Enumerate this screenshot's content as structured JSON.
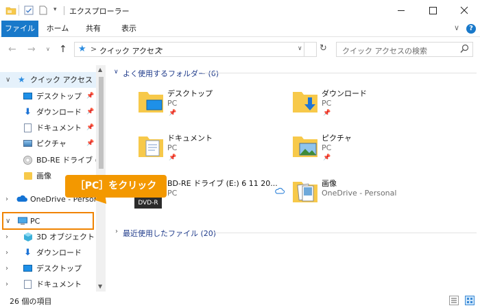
{
  "window": {
    "title": "エクスプローラー",
    "controls": [
      "minimize",
      "maximize",
      "close"
    ]
  },
  "ribbon": {
    "tabs": [
      {
        "label": "ファイル",
        "active": true
      },
      {
        "label": "ホーム"
      },
      {
        "label": "共有"
      },
      {
        "label": "表示"
      }
    ]
  },
  "address": {
    "path": "クイック アクセス",
    "separator": ">"
  },
  "search": {
    "placeholder": "クイック アクセスの検索"
  },
  "nav": {
    "items": [
      {
        "label": "クイック アクセス",
        "icon": "star-icon",
        "level": 0,
        "expanded": true
      },
      {
        "label": "デスクトップ",
        "icon": "desktop-icon",
        "level": 1,
        "pinned": true
      },
      {
        "label": "ダウンロード",
        "icon": "download-icon",
        "level": 1,
        "pinned": true
      },
      {
        "label": "ドキュメント",
        "icon": "document-icon",
        "level": 1,
        "pinned": true
      },
      {
        "label": "ピクチャ",
        "icon": "picture-icon",
        "level": 1,
        "pinned": true
      },
      {
        "label": "BD-RE ドライブ (E:",
        "icon": "disc-icon",
        "level": 1
      },
      {
        "label": "画像",
        "icon": "folder-icon",
        "level": 1
      },
      {
        "label": "OneDrive - Person",
        "icon": "cloud-icon",
        "level": 0,
        "expanded": false
      },
      {
        "label": "PC",
        "icon": "pc-icon",
        "level": 0,
        "expanded": true
      },
      {
        "label": "3D オブジェクト",
        "icon": "cube-icon",
        "level": 1
      },
      {
        "label": "ダウンロード",
        "icon": "download-icon",
        "level": 1
      },
      {
        "label": "デスクトップ",
        "icon": "desktop-icon",
        "level": 1
      },
      {
        "label": "ドキュメント",
        "icon": "document-icon",
        "level": 1
      }
    ]
  },
  "content": {
    "frequent_header": "よく使用するフォルダー (6)",
    "recent_header": "最近使用したファイル (20)",
    "folders": [
      {
        "name": "デスクトップ",
        "location": "PC",
        "pinned": true,
        "icon": "desktop-folder-icon"
      },
      {
        "name": "ダウンロード",
        "location": "PC",
        "pinned": true,
        "icon": "download-folder-icon"
      },
      {
        "name": "ドキュメント",
        "location": "PC",
        "pinned": true,
        "icon": "document-folder-icon"
      },
      {
        "name": "ピクチャ",
        "location": "PC",
        "pinned": true,
        "icon": "picture-folder-icon"
      },
      {
        "name": "BD-RE ドライブ (E:) 6 11 20...",
        "location": "PC",
        "pinned": false,
        "icon": "disc-drive-icon"
      },
      {
        "name": "画像",
        "location": "OneDrive - Personal",
        "pinned": false,
        "icon": "image-folder-icon",
        "cloud": true
      }
    ]
  },
  "status": {
    "item_count": "26 個の項目"
  },
  "annotation": {
    "callout": "［PC］をクリック",
    "tooltip": "DVD-R"
  },
  "colors": {
    "accent": "#1979ca",
    "callout": "#f39800",
    "folder": "#f7c94a",
    "group_header": "#1e3a8a"
  }
}
